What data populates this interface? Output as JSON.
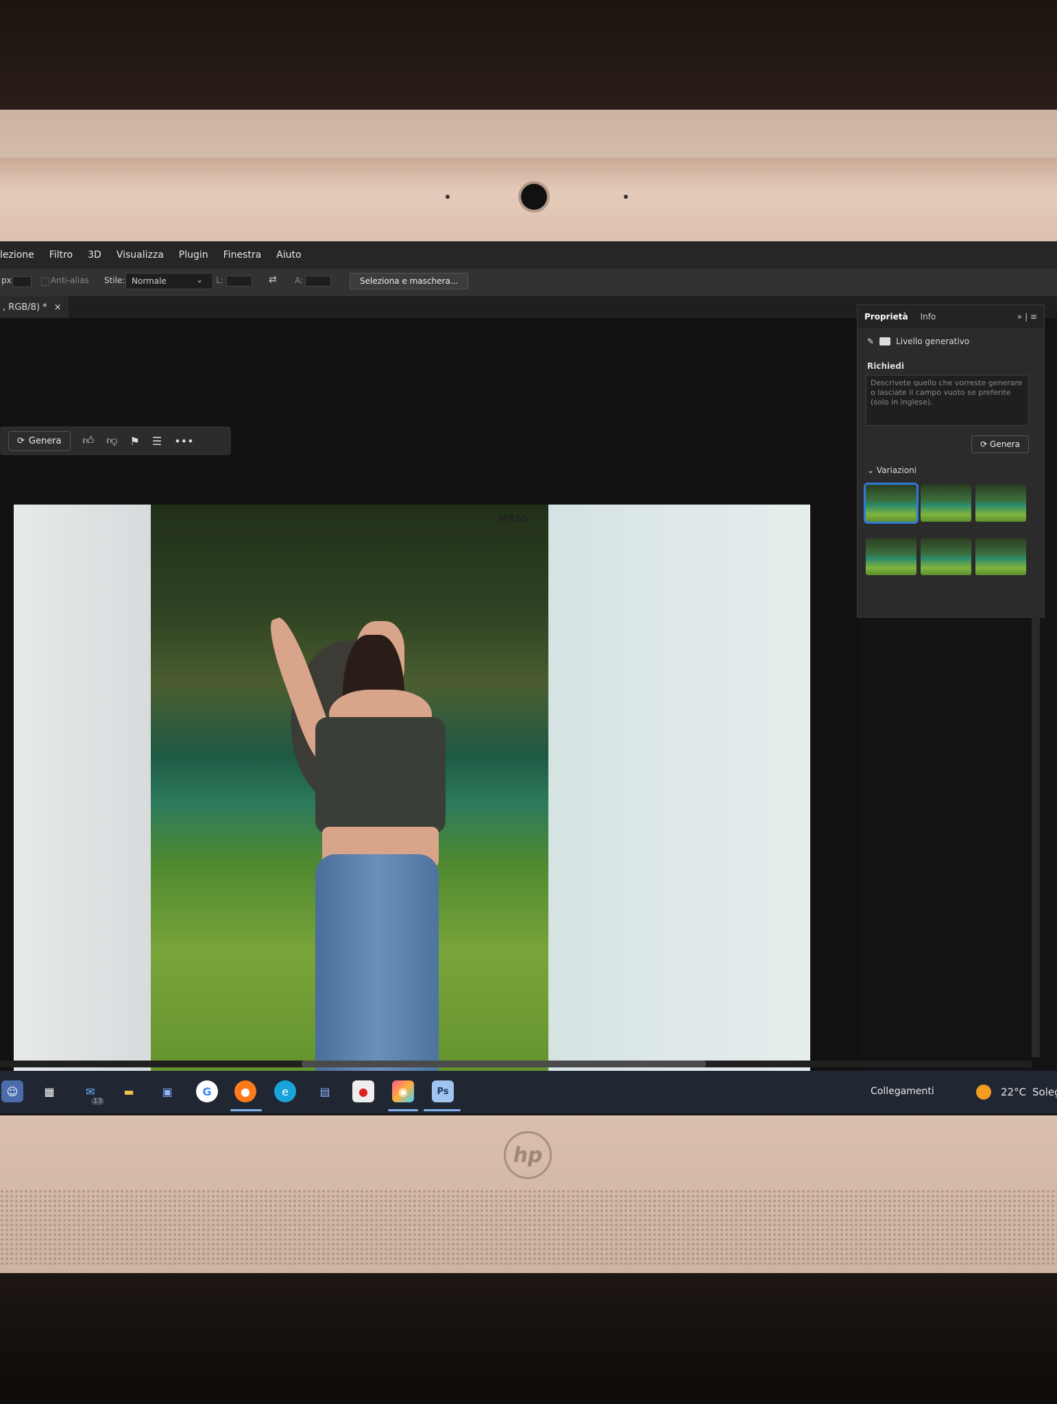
{
  "menubar": {
    "items": [
      "lezione",
      "Filtro",
      "3D",
      "Visualizza",
      "Plugin",
      "Finestra",
      "Aiuto"
    ]
  },
  "options_bar": {
    "unit_prefix": "px",
    "antialias_label": "Anti-alias",
    "style_label": "Stile:",
    "style_value": "Normale",
    "width_label": "L:",
    "height_label": "A:",
    "select_mask_button": "Seleziona e maschera..."
  },
  "document_tab": {
    "title": ", RGB/8) *",
    "close_glyph": "×"
  },
  "contextual_taskbar": {
    "generate_label": "Genera",
    "more_glyph": "•••"
  },
  "canvas": {
    "watermark": "MRSS"
  },
  "properties_panel": {
    "tabs": [
      "Proprietà",
      "Info"
    ],
    "layer_label": "Livello generativo",
    "prompt_label": "Richiedi",
    "prompt_placeholder": "Descrivete quello che vorreste generare o lasciate il campo vuoto se preferite (solo in inglese).",
    "generate_label": "Genera",
    "variations_label": "Variazioni",
    "variations_count": 6,
    "selected_variation": 1
  },
  "taskbar": {
    "mail_badge": "13",
    "links_label": "Collegamenti",
    "weather_temp": "22°C",
    "weather_text": "Soleg"
  },
  "monitor": {
    "brand": "hp"
  }
}
